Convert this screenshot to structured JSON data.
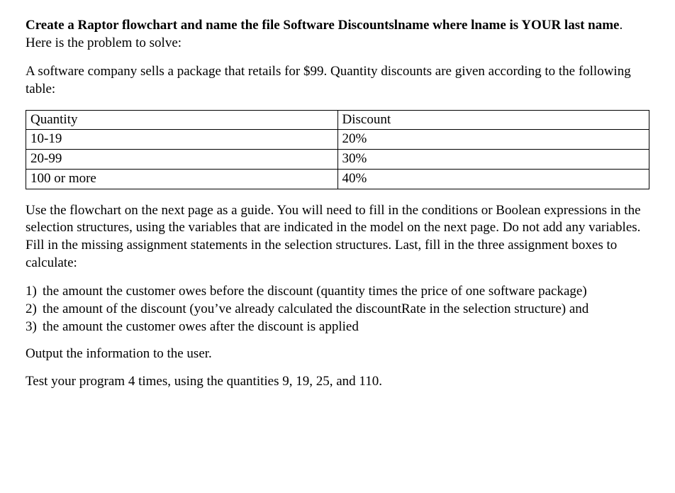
{
  "header": {
    "bold_part": "Create a Raptor flowchart and name the file Software Discountslname where lname is YOUR last name",
    "rest": ". Here is the problem to solve:"
  },
  "intro": "A software company sells a package that retails for $99. Quantity discounts are given according to the following table:",
  "table": {
    "header_left": "Quantity",
    "header_right": "Discount",
    "rows": [
      {
        "left": "10-19",
        "right": "20%"
      },
      {
        "left": "20-99",
        "right": "30%"
      },
      {
        "left": "100 or more",
        "right": "40%"
      }
    ]
  },
  "instructions1": "Use the flowchart on the next page as a guide. You will need to fill in the conditions or Boolean expressions in the selection structures, using the variables that are indicated in the model on the next page. Do not add any variables.  Fill in the missing assignment statements in the selection structures. Last, fill in the three assignment boxes to calculate:",
  "list": [
    {
      "num": "1)",
      "text": "the amount the customer owes before the discount (quantity times the price of one software package)"
    },
    {
      "num": "2)",
      "text": "the amount of the discount (you’ve already calculated the discountRate in the selection structure) and"
    },
    {
      "num": "3)",
      "text": "the amount the customer owes after the discount is applied"
    }
  ],
  "output_line": "Output the information to the user.",
  "test_line": "Test your program 4 times, using the quantities 9, 19, 25, and 110."
}
